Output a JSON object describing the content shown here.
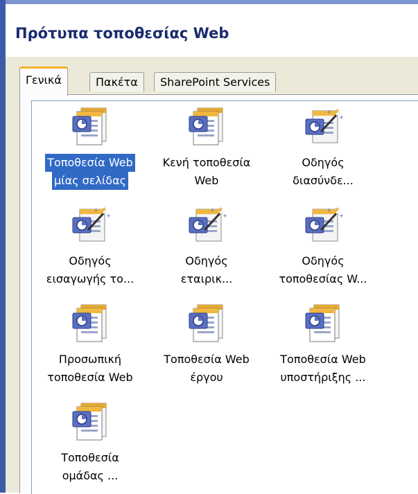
{
  "dialog": {
    "title": "Πρότυπα τοποθεσίας Web"
  },
  "tabs": [
    {
      "label": "Γενικά",
      "active": true
    },
    {
      "label": "Πακέτα",
      "active": false
    },
    {
      "label": "SharePoint Services",
      "active": false
    }
  ],
  "templates": [
    {
      "line1": "Τοποθεσία Web",
      "line2": "μίας σελίδας",
      "icon": "web-page-icon",
      "selected": true
    },
    {
      "line1": "Κενή τοποθεσία",
      "line2": "Web",
      "icon": "web-page-icon",
      "selected": false
    },
    {
      "line1": "Οδηγός",
      "line2": "διασύνδε...",
      "icon": "wizard-icon",
      "selected": false
    },
    {
      "line1": "Οδηγός",
      "line2": "εισαγωγής το...",
      "icon": "wizard-icon",
      "selected": false
    },
    {
      "line1": "Οδηγός",
      "line2": "εταιρικ...",
      "icon": "wizard-icon",
      "selected": false
    },
    {
      "line1": "Οδηγός",
      "line2": "τοποθεσίας W...",
      "icon": "wizard-icon",
      "selected": false
    },
    {
      "line1": "Προσωπική",
      "line2": "τοποθεσία Web",
      "icon": "web-page-icon",
      "selected": false
    },
    {
      "line1": "Τοποθεσία Web",
      "line2": "έργου",
      "icon": "web-page-icon",
      "selected": false
    },
    {
      "line1": "Τοποθεσία Web",
      "line2": "υποστήριξης ...",
      "icon": "web-page-icon",
      "selected": false
    },
    {
      "line1": "Τοποθεσία",
      "line2": "ομάδας ...",
      "icon": "web-page-icon",
      "selected": false
    }
  ],
  "colors": {
    "title_text": "#1a2c6e",
    "selection": "#316ac5",
    "active_tab_accent": "#f7b12d",
    "dialog_face": "#ece9d8"
  }
}
